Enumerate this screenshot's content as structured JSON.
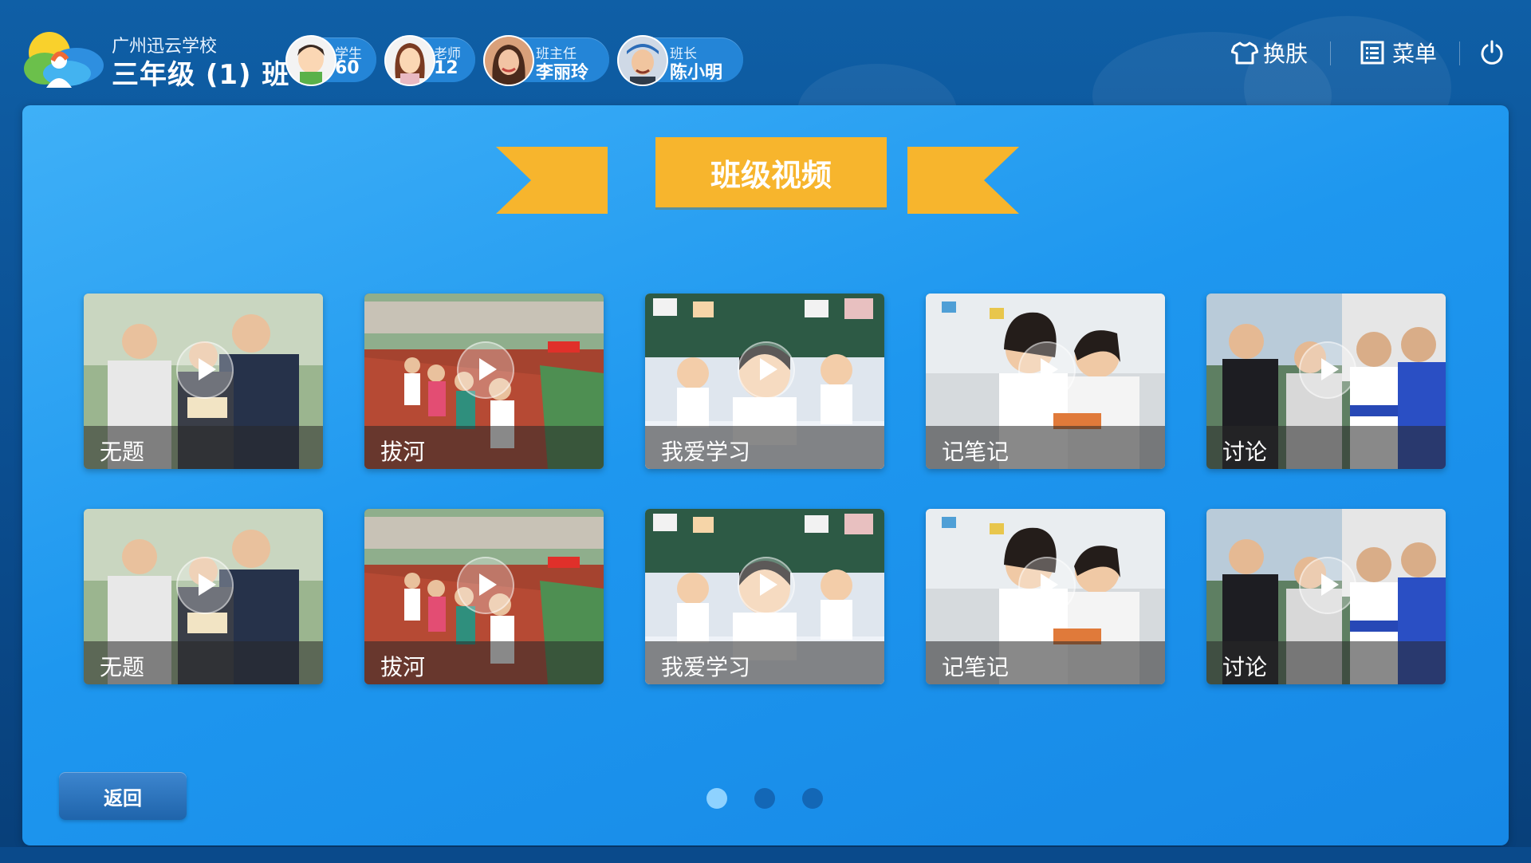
{
  "header": {
    "school": "广州迅云学校",
    "class_name": "三年级 (1) 班",
    "stats": [
      {
        "label": "学生",
        "value": "60",
        "icon": "boy-avatar-icon"
      },
      {
        "label": "老师",
        "value": "12",
        "icon": "girl-avatar-icon"
      },
      {
        "label": "班主任",
        "value": "李丽玲",
        "icon": "teacher-photo"
      },
      {
        "label": "班长",
        "value": "陈小明",
        "icon": "monitor-photo"
      }
    ],
    "actions": {
      "skin_label": "换肤",
      "menu_label": "菜单",
      "skin_icon": "tshirt-icon",
      "menu_icon": "list-icon",
      "power_icon": "power-icon"
    }
  },
  "page_title": "班级视频",
  "videos": [
    {
      "title": "无题"
    },
    {
      "title": "拔河"
    },
    {
      "title": "我爱学习"
    },
    {
      "title": "记笔记"
    },
    {
      "title": "讨论"
    },
    {
      "title": "无题"
    },
    {
      "title": "拔河"
    },
    {
      "title": "我爱学习"
    },
    {
      "title": "记笔记"
    },
    {
      "title": "讨论"
    }
  ],
  "back_label": "返回",
  "pagination": {
    "pages": 3,
    "current": 1
  },
  "colors": {
    "ribbon": "#f7b52d",
    "panel": "#1e97ef",
    "background": "#0f5fa6",
    "dot_active": "#8ed2ff",
    "dot_inactive": "#1367b6"
  }
}
